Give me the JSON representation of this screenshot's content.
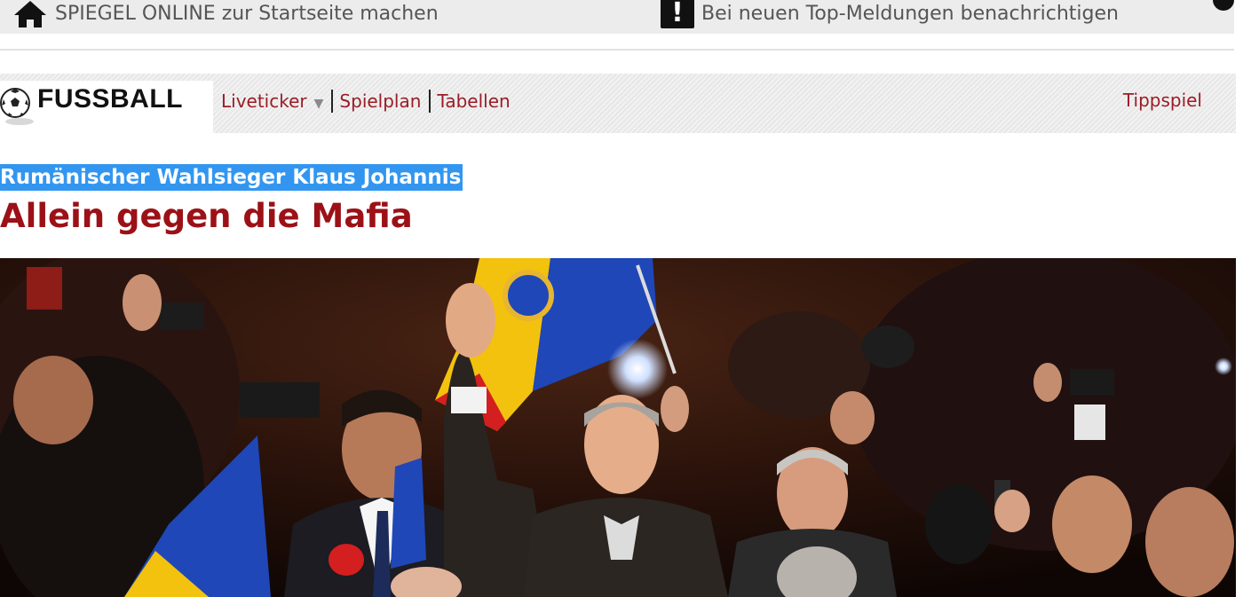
{
  "topbar": {
    "home_label": "SPIEGEL ONLINE zur Startseite machen",
    "home_icon": "home-icon",
    "notify_label": "Bei neuen Top-Meldungen benachrichtigen",
    "notify_icon": "alert-icon",
    "notify_glyph": "!"
  },
  "section": {
    "title": "FUSSBALL",
    "icon": "soccer-ball-icon",
    "nav": [
      {
        "label": "Liveticker",
        "has_dropdown": true
      },
      {
        "label": "Spielplan"
      },
      {
        "label": "Tabellen"
      }
    ],
    "tippspiel": "Tippspiel"
  },
  "article": {
    "kicker": "Rumänischer Wahlsieger Klaus Johannis",
    "headline": "Allein gegen die Mafia",
    "image_subject": "crowd-with-romanian-flags-photo"
  },
  "colors": {
    "link": "#9a1d26",
    "headline": "#9b1117",
    "selection": "#3296f0",
    "flag_blue": "#1f47b8",
    "flag_yellow": "#f2c20f",
    "flag_red": "#d31f1f"
  }
}
